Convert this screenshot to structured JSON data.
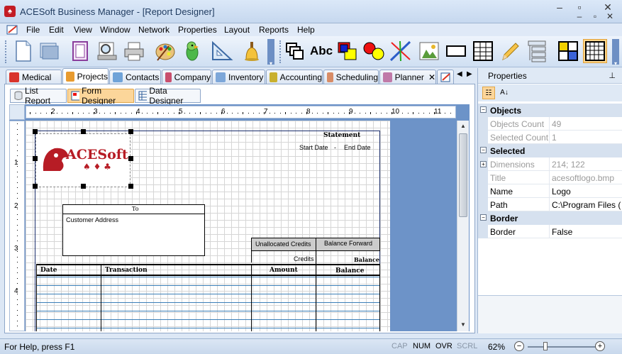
{
  "window": {
    "title": "ACESoft Business Manager - [Report Designer]",
    "minimize": "–",
    "restore": "▫",
    "close": "✕",
    "doc_minimize": "–",
    "doc_restore": "▫",
    "doc_close": "✕"
  },
  "menu": {
    "items": [
      "File",
      "Edit",
      "View",
      "Window",
      "Network",
      "Properties",
      "Layout",
      "Reports",
      "Help"
    ]
  },
  "toolbar": {
    "left_group": [
      "new-document",
      "open-folder",
      "report-pages",
      "print-preview",
      "print",
      "palette",
      "parrot",
      "ruler-triangle",
      "bell"
    ],
    "right_group": [
      "copy-windows",
      "text",
      "shapes",
      "line",
      "picture",
      "rectangle",
      "table",
      "pencil",
      "stack",
      "grid-color",
      "grid"
    ],
    "text_button_label": "Abc"
  },
  "module_tabs": [
    {
      "label": "Medical",
      "color": "#d9342b"
    },
    {
      "label": "Projects",
      "color": "#e89b2f",
      "active": true
    },
    {
      "label": "Contacts",
      "color": "#6fa3d8"
    },
    {
      "label": "Company",
      "color": "#c94f6d"
    },
    {
      "label": "Inventory",
      "color": "#7da7d9"
    },
    {
      "label": "Accounting",
      "color": "#c9b02f"
    },
    {
      "label": "Scheduling",
      "color": "#d88c66"
    },
    {
      "label": "Planner",
      "color": "#c07aa8"
    }
  ],
  "tab_nav": {
    "prev": "◀",
    "next": "▶"
  },
  "sub_tabs": [
    {
      "label": "List Report"
    },
    {
      "label": "Form Designer",
      "active": true
    },
    {
      "label": "Data Designer"
    }
  ],
  "ruler": {
    "h_numbers": [
      "2",
      "3",
      "4",
      "5",
      "6",
      "7",
      "8",
      "9",
      "10",
      "11"
    ],
    "v_numbers": [
      "1",
      "2",
      "3",
      "4"
    ]
  },
  "report": {
    "logo_text": "ACESoft",
    "statement": "Statement",
    "start_date": "Start Date",
    "dash": "-",
    "end_date": "End Date",
    "to": "To",
    "customer_address": "Customer Address",
    "unallocated_credits": "Unallocated Credits",
    "balance_forward": "Balance Forward",
    "credits": "Credits",
    "balance_small": "Balance",
    "columns": [
      "Date",
      "Transaction",
      "Amount",
      "Balance"
    ]
  },
  "properties": {
    "title": "Properties",
    "pin": "📌",
    "categories": [
      {
        "name": "Objects",
        "rows": [
          {
            "key": "Objects Count",
            "value": "49",
            "disabled": true
          },
          {
            "key": "Selected Count",
            "value": "1",
            "disabled": true
          }
        ]
      },
      {
        "name": "Selected",
        "rows": [
          {
            "key": "Dimensions",
            "value": "214; 122",
            "disabled": true,
            "expandable": true
          },
          {
            "key": "Title",
            "value": "acesoftlogo.bmp",
            "disabled": true
          },
          {
            "key": "Name",
            "value": "Logo",
            "disabled": false
          },
          {
            "key": "Path",
            "value": "C:\\Program Files (",
            "disabled": false
          }
        ]
      },
      {
        "name": "Border",
        "rows": [
          {
            "key": "Border",
            "value": "False",
            "disabled": false
          }
        ]
      }
    ],
    "expand_symbol": "−",
    "plus_symbol": "+"
  },
  "status": {
    "help": "For Help, press F1",
    "indicators": [
      {
        "label": "CAP",
        "on": false
      },
      {
        "label": "NUM",
        "on": true
      },
      {
        "label": "OVR",
        "on": true
      },
      {
        "label": "SCRL",
        "on": false
      }
    ],
    "zoom": "62%",
    "zoom_minus": "−",
    "zoom_plus": "+"
  }
}
